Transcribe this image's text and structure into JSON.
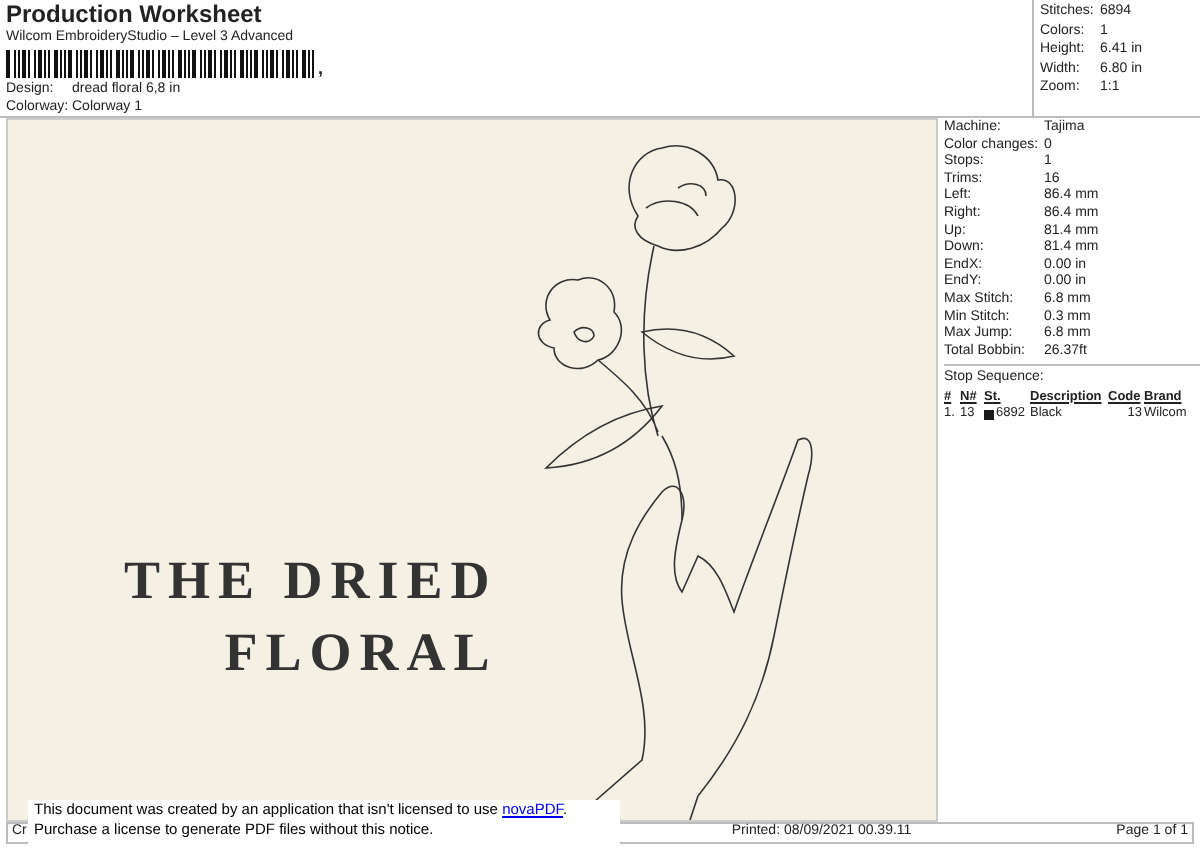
{
  "header": {
    "title": "Production Worksheet",
    "subtitle": "Wilcom EmbroideryStudio – Level 3 Advanced",
    "barcode_suffix": ",",
    "fields": [
      {
        "label": "Design:",
        "value": "dread floral 6,8 in"
      },
      {
        "label": "Colorway:",
        "value": "Colorway 1"
      }
    ]
  },
  "summary": [
    {
      "label": "Stitches:",
      "value": "6894"
    },
    {
      "label": "Colors:",
      "value": "1"
    },
    {
      "label": "Height:",
      "value": "6.41 in"
    },
    {
      "label": "Width:",
      "value": "6.80 in"
    },
    {
      "label": "Zoom:",
      "value": "1:1"
    }
  ],
  "design_preview": {
    "lines": [
      "THE DRIED",
      "FLORAL"
    ]
  },
  "machine_info": [
    {
      "label": "Machine:",
      "value": "Tajima"
    },
    {
      "label": "Color changes:",
      "value": "0"
    },
    {
      "label": "Stops:",
      "value": "1"
    },
    {
      "label": "Trims:",
      "value": "16"
    },
    {
      "label": "Left:",
      "value": "86.4 mm"
    },
    {
      "label": "Right:",
      "value": "86.4 mm"
    },
    {
      "label": "Up:",
      "value": "81.4 mm"
    },
    {
      "label": "Down:",
      "value": "81.4 mm"
    },
    {
      "label": "EndX:",
      "value": "0.00 in"
    },
    {
      "label": "EndY:",
      "value": "0.00 in"
    },
    {
      "label": "Max Stitch:",
      "value": "6.8 mm"
    },
    {
      "label": "Min Stitch:",
      "value": "0.3 mm"
    },
    {
      "label": "Max Jump:",
      "value": "6.8 mm"
    },
    {
      "label": "Total Bobbin:",
      "value": "26.37ft"
    }
  ],
  "stop_sequence": {
    "title": "Stop Sequence:",
    "columns": [
      "#",
      "N#",
      "St.",
      "Description",
      "Code",
      "Brand"
    ],
    "rows": [
      {
        "number": "1.",
        "needle": "13",
        "color": "#1a1a1a",
        "stitches": "6892",
        "description": "Black",
        "code": "13",
        "brand": "Wilcom"
      }
    ]
  },
  "footer": {
    "left": "Cr",
    "printed": "Printed: 08/09/2021 00.39.11",
    "page": "Page 1 of 1"
  },
  "notice": {
    "line_1": "This document was created by an application that isn't licensed to use",
    "link": "novaPDF",
    "line_1_end": ".",
    "line_2": "Purchase a license to generate PDF files without this notice."
  }
}
